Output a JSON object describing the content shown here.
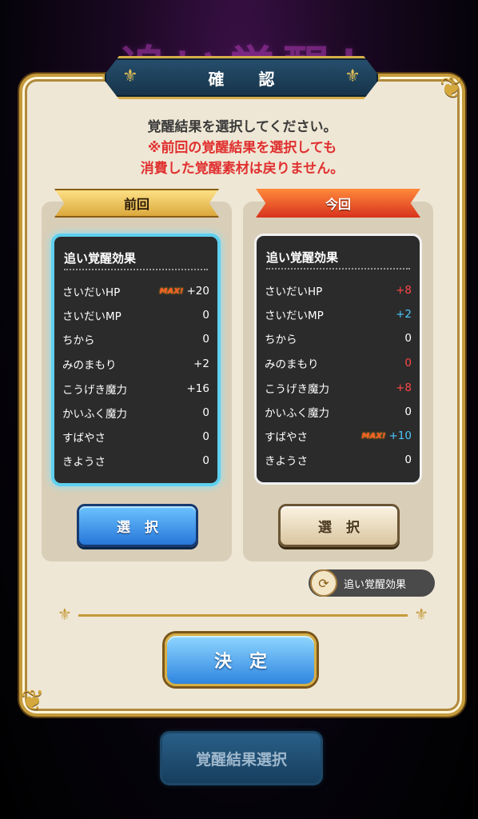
{
  "background_title": "追い覚醒！",
  "dialog": {
    "title": "確 認",
    "message_line1": "覚醒結果を選択してください。",
    "warning_line1": "※前回の覚醒結果を選択しても",
    "warning_line2": "消費した覚醒素材は戻りません。",
    "colors": {
      "warning": "#e03030",
      "selected_border": "#5fd0ef",
      "accent_gold": "#c49a3a"
    }
  },
  "previous": {
    "label": "前回",
    "selected": true,
    "stats_title": "追い覚醒効果",
    "stats": [
      {
        "name": "さいだいHP",
        "badge": "MAX!",
        "value": "+20"
      },
      {
        "name": "さいだいMP",
        "badge": "",
        "value": "0"
      },
      {
        "name": "ちから",
        "badge": "",
        "value": "0"
      },
      {
        "name": "みのまもり",
        "badge": "",
        "value": "+2"
      },
      {
        "name": "こうげき魔力",
        "badge": "",
        "value": "+16"
      },
      {
        "name": "かいふく魔力",
        "badge": "",
        "value": "0"
      },
      {
        "name": "すばやさ",
        "badge": "",
        "value": "0"
      },
      {
        "name": "きようさ",
        "badge": "",
        "value": "0"
      }
    ],
    "button_label": "選択"
  },
  "current": {
    "label": "今回",
    "selected": false,
    "stats_title": "追い覚醒効果",
    "stats": [
      {
        "name": "さいだいHP",
        "badge": "",
        "value": "+8",
        "color": "red"
      },
      {
        "name": "さいだいMP",
        "badge": "",
        "value": "+2",
        "color": "blue"
      },
      {
        "name": "ちから",
        "badge": "",
        "value": "0",
        "color": ""
      },
      {
        "name": "みのまもり",
        "badge": "",
        "value": "0",
        "color": "red"
      },
      {
        "name": "こうげき魔力",
        "badge": "",
        "value": "+8",
        "color": "red"
      },
      {
        "name": "かいふく魔力",
        "badge": "",
        "value": "0",
        "color": ""
      },
      {
        "name": "すばやさ",
        "badge": "MAX!",
        "value": "+10",
        "color": "blue"
      },
      {
        "name": "きようさ",
        "badge": "",
        "value": "0",
        "color": ""
      }
    ],
    "button_label": "選択"
  },
  "toggle_label": "追い覚醒効果",
  "decide_label": "決定",
  "bottom_button_label": "覚醒結果選択"
}
